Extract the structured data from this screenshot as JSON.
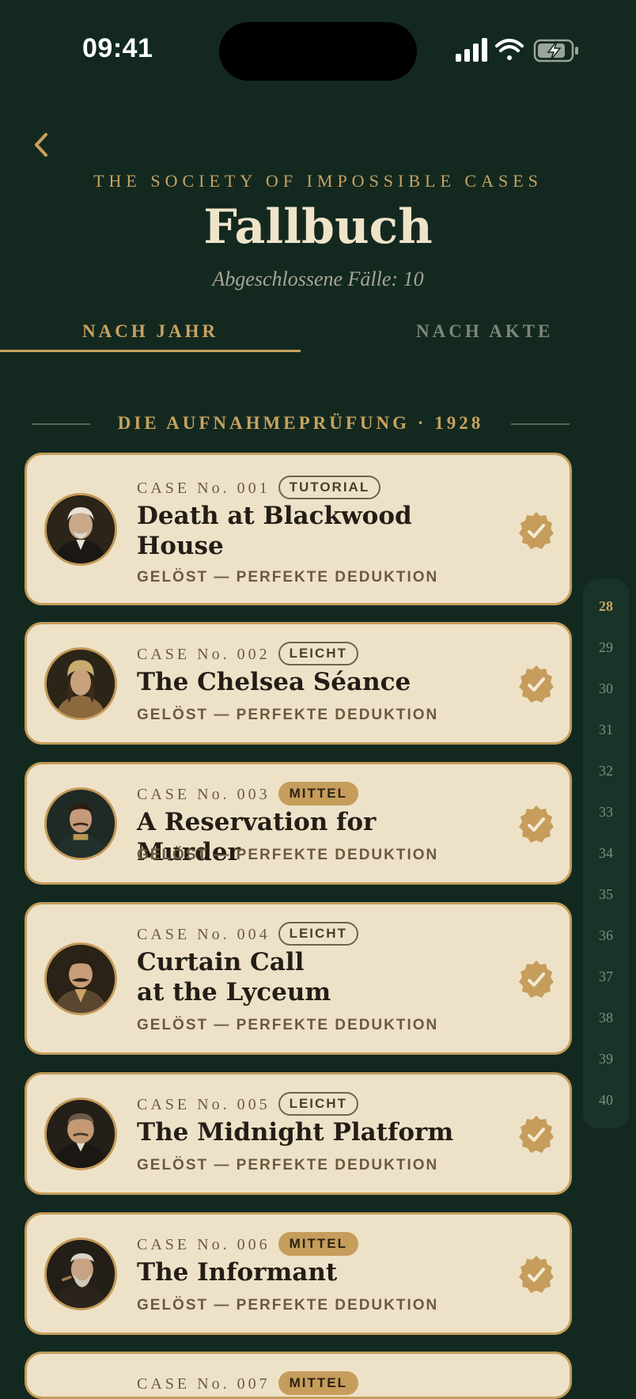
{
  "status_bar": {
    "time": "09:41"
  },
  "header": {
    "eyebrow": "THE SOCIETY OF IMPOSSIBLE CASES",
    "title": "Fallbuch",
    "subtitle": "Abgeschlossene Fälle: 10"
  },
  "tabs": [
    {
      "label": "NACH JAHR",
      "active": true
    },
    {
      "label": "NACH AKTE",
      "active": false
    }
  ],
  "section": {
    "title": "DIE AUFNAHMEPRÜFUNG · 1928"
  },
  "cases": [
    {
      "number": "CASE No. 001",
      "difficulty": "TUTORIAL",
      "difficulty_style": "outline",
      "title": "Death at Blackwood House",
      "status": "GELÖST — PERFEKTE DEDUKTION",
      "portrait": "portrait-old-gentleman"
    },
    {
      "number": "CASE No. 002",
      "difficulty": "LEICHT",
      "difficulty_style": "outline",
      "title": "The Chelsea Séance",
      "status": "GELÖST — PERFEKTE DEDUKTION",
      "portrait": "portrait-turbaned-woman"
    },
    {
      "number": "CASE No. 003",
      "difficulty": "MITTEL",
      "difficulty_style": "filled",
      "title": "A Reservation for Murder",
      "status": "GELÖST — PERFEKTE DEDUKTION",
      "portrait": "portrait-uniformed-man"
    },
    {
      "number": "CASE No. 004",
      "difficulty": "LEICHT",
      "difficulty_style": "outline",
      "title": "Curtain Call at the Lyceum",
      "status": "GELÖST — PERFEKTE DEDUKTION",
      "portrait": "portrait-mustached-man"
    },
    {
      "number": "CASE No. 005",
      "difficulty": "LEICHT",
      "difficulty_style": "outline",
      "title": "The Midnight Platform",
      "status": "GELÖST — PERFEKTE DEDUKTION",
      "portrait": "portrait-stout-man"
    },
    {
      "number": "CASE No. 006",
      "difficulty": "MITTEL",
      "difficulty_style": "filled",
      "title": "The Informant",
      "status": "GELÖST — PERFEKTE DEDUKTION",
      "portrait": "portrait-bearded-man"
    },
    {
      "number": "CASE No. 007",
      "difficulty": "MITTEL",
      "difficulty_style": "filled",
      "title": "",
      "status": "",
      "portrait": ""
    }
  ],
  "year_index": {
    "active": "28",
    "items": [
      "28",
      "29",
      "30",
      "31",
      "32",
      "33",
      "34",
      "35",
      "36",
      "37",
      "38",
      "39",
      "40"
    ]
  },
  "colors": {
    "background": "#132920",
    "accent_gold": "#c9a25e",
    "card": "#ede2c8",
    "title_cream": "#efe4c9"
  }
}
